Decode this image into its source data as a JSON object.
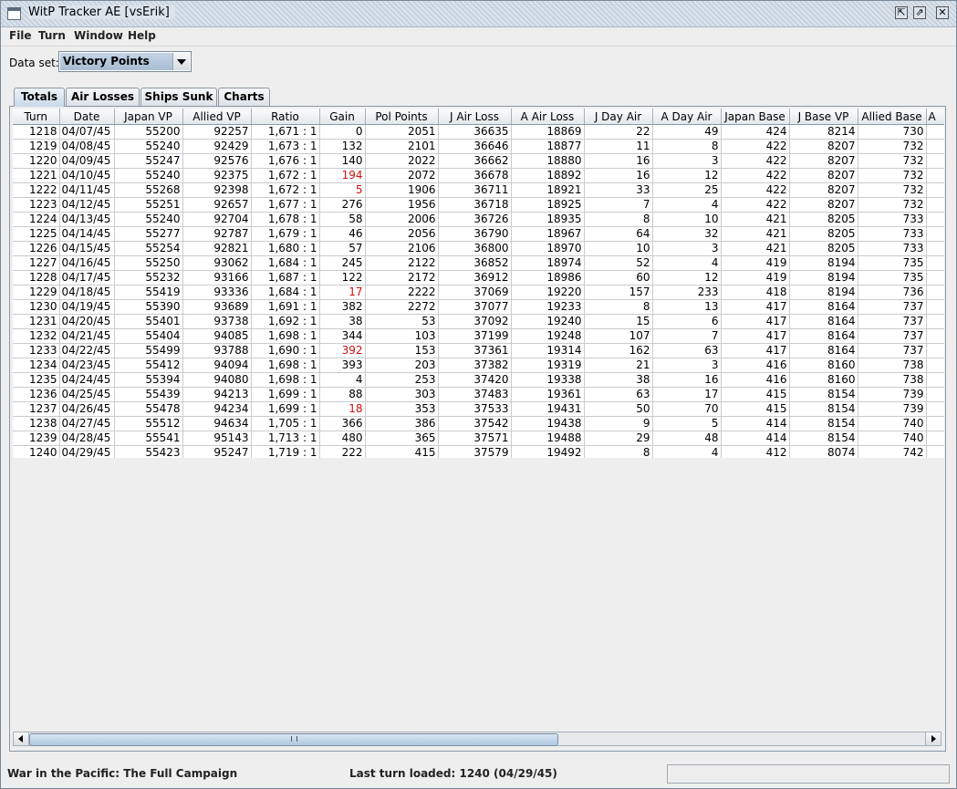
{
  "window": {
    "title": "WitP Tracker AE [vsErik]"
  },
  "menu": [
    {
      "label": "File"
    },
    {
      "label": "Turn"
    },
    {
      "label": "Window"
    },
    {
      "label": "Help"
    }
  ],
  "dataset": {
    "label": "Data set:",
    "value": "Victory Points"
  },
  "tabs": [
    {
      "label": "Totals",
      "active": true
    },
    {
      "label": "Air Losses",
      "active": false
    },
    {
      "label": "Ships Sunk",
      "active": false
    },
    {
      "label": "Charts",
      "active": false
    }
  ],
  "table": {
    "columns": [
      "Turn",
      "Date",
      "Japan VP",
      "Allied VP",
      "Ratio",
      "Gain",
      "Pol Points",
      "J Air Loss",
      "A Air Loss",
      "J Day Air",
      "A Day Air",
      "Japan Base",
      "J Base VP",
      "Allied Base",
      "A"
    ],
    "rows": [
      [
        "1218",
        "04/07/45",
        "55200",
        "92257",
        "1,671 : 1",
        "0",
        "2051",
        "36635",
        "18869",
        "22",
        "49",
        "424",
        "8214",
        "730"
      ],
      [
        "1219",
        "04/08/45",
        "55240",
        "92429",
        "1,673 : 1",
        "132",
        "2101",
        "36646",
        "18877",
        "11",
        "8",
        "422",
        "8207",
        "732"
      ],
      [
        "1220",
        "04/09/45",
        "55247",
        "92576",
        "1,676 : 1",
        "140",
        "2022",
        "36662",
        "18880",
        "16",
        "3",
        "422",
        "8207",
        "732"
      ],
      [
        "1221",
        "04/10/45",
        "55240",
        "92375",
        "1,672 : 1",
        "194",
        "2072",
        "36678",
        "18892",
        "16",
        "12",
        "422",
        "8207",
        "732"
      ],
      [
        "1222",
        "04/11/45",
        "55268",
        "92398",
        "1,672 : 1",
        "5",
        "1906",
        "36711",
        "18921",
        "33",
        "25",
        "422",
        "8207",
        "732"
      ],
      [
        "1223",
        "04/12/45",
        "55251",
        "92657",
        "1,677 : 1",
        "276",
        "1956",
        "36718",
        "18925",
        "7",
        "4",
        "422",
        "8207",
        "732"
      ],
      [
        "1224",
        "04/13/45",
        "55240",
        "92704",
        "1,678 : 1",
        "58",
        "2006",
        "36726",
        "18935",
        "8",
        "10",
        "421",
        "8205",
        "733"
      ],
      [
        "1225",
        "04/14/45",
        "55277",
        "92787",
        "1,679 : 1",
        "46",
        "2056",
        "36790",
        "18967",
        "64",
        "32",
        "421",
        "8205",
        "733"
      ],
      [
        "1226",
        "04/15/45",
        "55254",
        "92821",
        "1,680 : 1",
        "57",
        "2106",
        "36800",
        "18970",
        "10",
        "3",
        "421",
        "8205",
        "733"
      ],
      [
        "1227",
        "04/16/45",
        "55250",
        "93062",
        "1,684 : 1",
        "245",
        "2122",
        "36852",
        "18974",
        "52",
        "4",
        "419",
        "8194",
        "735"
      ],
      [
        "1228",
        "04/17/45",
        "55232",
        "93166",
        "1,687 : 1",
        "122",
        "2172",
        "36912",
        "18986",
        "60",
        "12",
        "419",
        "8194",
        "735"
      ],
      [
        "1229",
        "04/18/45",
        "55419",
        "93336",
        "1,684 : 1",
        "17",
        "2222",
        "37069",
        "19220",
        "157",
        "233",
        "418",
        "8194",
        "736"
      ],
      [
        "1230",
        "04/19/45",
        "55390",
        "93689",
        "1,691 : 1",
        "382",
        "2272",
        "37077",
        "19233",
        "8",
        "13",
        "417",
        "8164",
        "737"
      ],
      [
        "1231",
        "04/20/45",
        "55401",
        "93738",
        "1,692 : 1",
        "38",
        "53",
        "37092",
        "19240",
        "15",
        "6",
        "417",
        "8164",
        "737"
      ],
      [
        "1232",
        "04/21/45",
        "55404",
        "94085",
        "1,698 : 1",
        "344",
        "103",
        "37199",
        "19248",
        "107",
        "7",
        "417",
        "8164",
        "737"
      ],
      [
        "1233",
        "04/22/45",
        "55499",
        "93788",
        "1,690 : 1",
        "392",
        "153",
        "37361",
        "19314",
        "162",
        "63",
        "417",
        "8164",
        "737"
      ],
      [
        "1234",
        "04/23/45",
        "55412",
        "94094",
        "1,698 : 1",
        "393",
        "203",
        "37382",
        "19319",
        "21",
        "3",
        "416",
        "8160",
        "738"
      ],
      [
        "1235",
        "04/24/45",
        "55394",
        "94080",
        "1,698 : 1",
        "4",
        "253",
        "37420",
        "19338",
        "38",
        "16",
        "416",
        "8160",
        "738"
      ],
      [
        "1236",
        "04/25/45",
        "55439",
        "94213",
        "1,699 : 1",
        "88",
        "303",
        "37483",
        "19361",
        "63",
        "17",
        "415",
        "8154",
        "739"
      ],
      [
        "1237",
        "04/26/45",
        "55478",
        "94234",
        "1,699 : 1",
        "18",
        "353",
        "37533",
        "19431",
        "50",
        "70",
        "415",
        "8154",
        "739"
      ],
      [
        "1238",
        "04/27/45",
        "55512",
        "94634",
        "1,705 : 1",
        "366",
        "386",
        "37542",
        "19438",
        "9",
        "5",
        "414",
        "8154",
        "740"
      ],
      [
        "1239",
        "04/28/45",
        "55541",
        "95143",
        "1,713 : 1",
        "480",
        "365",
        "37571",
        "19488",
        "29",
        "48",
        "414",
        "8154",
        "740"
      ],
      [
        "1240",
        "04/29/45",
        "55423",
        "95247",
        "1,719 : 1",
        "222",
        "415",
        "37579",
        "19492",
        "8",
        "4",
        "412",
        "8074",
        "742"
      ]
    ],
    "red_gain_rows": [
      3,
      4,
      11,
      15,
      19
    ],
    "negative_color": "#d01010"
  },
  "status": {
    "campaign": "War in the Pacific: The Full Campaign",
    "last_turn": "Last turn loaded: 1240 (04/29/45)"
  }
}
